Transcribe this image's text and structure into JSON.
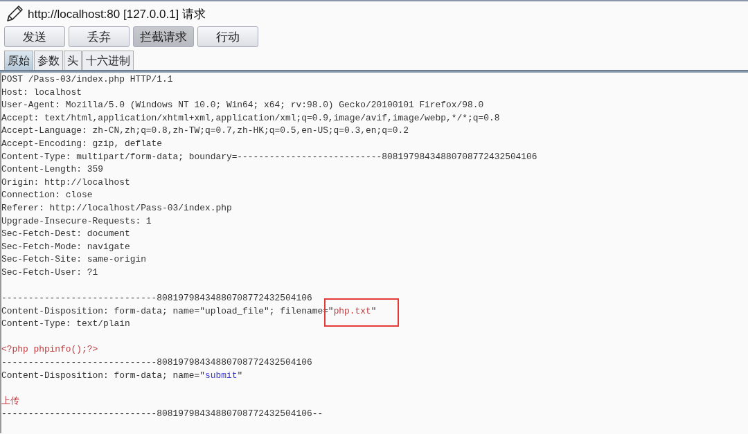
{
  "header": {
    "title": "http://localhost:80  [127.0.0.1] 请求"
  },
  "buttons": [
    {
      "label": "发送",
      "on": false
    },
    {
      "label": "丢弃",
      "on": false
    },
    {
      "label": "拦截请求",
      "on": true
    },
    {
      "label": "行动",
      "on": false
    }
  ],
  "tabs": [
    {
      "label": "原始",
      "selected": true
    },
    {
      "label": "参数",
      "selected": false
    },
    {
      "label": "头",
      "selected": false
    },
    {
      "label": "十六进制",
      "selected": false
    }
  ],
  "editor": {
    "lines": [
      {
        "kind": "text",
        "segments": [
          {
            "text": "POST /Pass-03/index.php HTTP/1.1",
            "kind": "plain"
          }
        ]
      },
      {
        "kind": "text",
        "segments": [
          {
            "text": "Host: localhost",
            "kind": "plain"
          }
        ]
      },
      {
        "kind": "text",
        "segments": [
          {
            "text": "User-Agent: Mozilla/5.0 (Windows NT 10.0; Win64; x64; rv:98.0) Gecko/20100101 Firefox/98.0",
            "kind": "plain"
          }
        ]
      },
      {
        "kind": "text",
        "segments": [
          {
            "text": "Accept: text/html,application/xhtml+xml,application/xml;q=0.9,image/avif,image/webp,*/*;q=0.8",
            "kind": "plain"
          }
        ]
      },
      {
        "kind": "text",
        "segments": [
          {
            "text": "Accept-Language: zh-CN,zh;q=0.8,zh-TW;q=0.7,zh-HK;q=0.5,en-US;q=0.3,en;q=0.2",
            "kind": "plain"
          }
        ]
      },
      {
        "kind": "text",
        "segments": [
          {
            "text": "Accept-Encoding: gzip, deflate",
            "kind": "plain"
          }
        ]
      },
      {
        "kind": "text",
        "segments": [
          {
            "text": "Content-Type: multipart/form-data; boundary=---------------------------80819798434880708772432504106",
            "kind": "plain"
          }
        ]
      },
      {
        "kind": "text",
        "segments": [
          {
            "text": "Content-Length: 359",
            "kind": "plain"
          }
        ]
      },
      {
        "kind": "text",
        "segments": [
          {
            "text": "Origin: http://localhost",
            "kind": "plain"
          }
        ]
      },
      {
        "kind": "text",
        "segments": [
          {
            "text": "Connection: close",
            "kind": "plain"
          }
        ]
      },
      {
        "kind": "text",
        "segments": [
          {
            "text": "Referer: http://localhost/Pass-03/index.php",
            "kind": "plain"
          }
        ]
      },
      {
        "kind": "text",
        "segments": [
          {
            "text": "Upgrade-Insecure-Requests: 1",
            "kind": "plain"
          }
        ]
      },
      {
        "kind": "text",
        "segments": [
          {
            "text": "Sec-Fetch-Dest: document",
            "kind": "plain"
          }
        ]
      },
      {
        "kind": "text",
        "segments": [
          {
            "text": "Sec-Fetch-Mode: navigate",
            "kind": "plain"
          }
        ]
      },
      {
        "kind": "text",
        "segments": [
          {
            "text": "Sec-Fetch-Site: same-origin",
            "kind": "plain"
          }
        ]
      },
      {
        "kind": "text",
        "segments": [
          {
            "text": "Sec-Fetch-User: ?1",
            "kind": "plain"
          }
        ]
      },
      {
        "kind": "blank"
      },
      {
        "kind": "text",
        "segments": [
          {
            "text": "-----------------------------80819798434880708772432504106",
            "kind": "plain"
          }
        ]
      },
      {
        "kind": "text",
        "boxed": true,
        "segments": [
          {
            "text": "Content-Disposition: form-data; name=\"upload_file\"; filename=\"",
            "kind": "plain"
          },
          {
            "text": "php.txt",
            "kind": "red"
          },
          {
            "text": "\"",
            "kind": "plain"
          }
        ]
      },
      {
        "kind": "text",
        "segments": [
          {
            "text": "Content-Type: text/plain",
            "kind": "plain"
          }
        ]
      },
      {
        "kind": "blank"
      },
      {
        "kind": "text",
        "segments": [
          {
            "text": "<?php phpinfo();?>",
            "kind": "red"
          }
        ]
      },
      {
        "kind": "text",
        "segments": [
          {
            "text": "-----------------------------80819798434880708772432504106",
            "kind": "plain"
          }
        ]
      },
      {
        "kind": "text",
        "segments": [
          {
            "text": "Content-Disposition: form-data; name=\"",
            "kind": "plain"
          },
          {
            "text": "submit",
            "kind": "blue"
          },
          {
            "text": "\"",
            "kind": "plain"
          }
        ]
      },
      {
        "kind": "blank"
      },
      {
        "kind": "text",
        "segments": [
          {
            "text": "上传",
            "kind": "red"
          }
        ]
      },
      {
        "kind": "text",
        "segments": [
          {
            "text": "-----------------------------80819798434880708772432504106--",
            "kind": "plain"
          }
        ]
      }
    ]
  }
}
